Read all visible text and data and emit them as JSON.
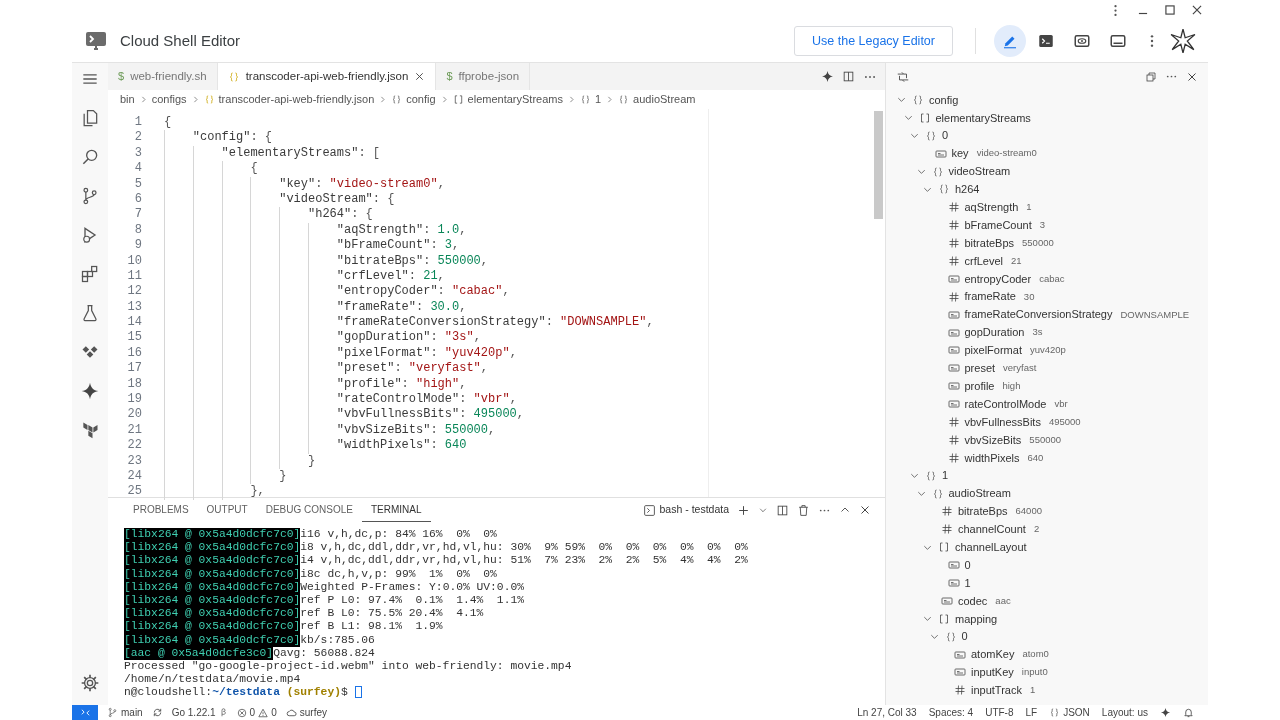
{
  "header": {
    "title": "Cloud Shell Editor",
    "legacy_button": "Use the Legacy Editor",
    "mode_buttons": [
      {
        "kind": "editor",
        "selected": true
      },
      {
        "kind": "terminal",
        "selected": false
      },
      {
        "kind": "preview",
        "selected": false
      },
      {
        "kind": "panel",
        "selected": false
      }
    ]
  },
  "tabs": [
    {
      "kind": "shell",
      "icon": "$",
      "label": "web-friendly.sh",
      "selected": false
    },
    {
      "kind": "json",
      "label": "transcoder-api-web-friendly.json",
      "selected": true
    },
    {
      "kind": "shell",
      "icon": "$",
      "label": "ffprobe-json",
      "selected": false
    }
  ],
  "breadcrumb": [
    {
      "kind": "folder",
      "label": "bin"
    },
    {
      "kind": "folder",
      "label": "configs"
    },
    {
      "kind": "file",
      "label": "transcoder-api-web-friendly.json"
    },
    {
      "kind": "object",
      "label": "config"
    },
    {
      "kind": "array",
      "label": "elementaryStreams"
    },
    {
      "kind": "object",
      "label": "1"
    },
    {
      "kind": "object",
      "label": "audioStream"
    }
  ],
  "code_lines": [
    {
      "number": "1",
      "text": "{"
    },
    {
      "number": "2",
      "text": "    \"config\": {"
    },
    {
      "number": "3",
      "text": "        \"elementaryStreams\": ["
    },
    {
      "number": "4",
      "text": "            {"
    },
    {
      "number": "5",
      "text": "                \"key\": \"video-stream0\","
    },
    {
      "number": "6",
      "text": "                \"videoStream\": {"
    },
    {
      "number": "7",
      "text": "                    \"h264\": {"
    },
    {
      "number": "8",
      "text": "                        \"aqStrength\": 1.0,"
    },
    {
      "number": "9",
      "text": "                        \"bFrameCount\": 3,"
    },
    {
      "number": "10",
      "text": "                        \"bitrateBps\": 550000,"
    },
    {
      "number": "11",
      "text": "                        \"crfLevel\": 21,"
    },
    {
      "number": "12",
      "text": "                        \"entropyCoder\": \"cabac\","
    },
    {
      "number": "13",
      "text": "                        \"frameRate\": 30.0,"
    },
    {
      "number": "14",
      "text": "                        \"frameRateConversionStrategy\": \"DOWNSAMPLE\","
    },
    {
      "number": "15",
      "text": "                        \"gopDuration\": \"3s\","
    },
    {
      "number": "16",
      "text": "                        \"pixelFormat\": \"yuv420p\","
    },
    {
      "number": "17",
      "text": "                        \"preset\": \"veryfast\","
    },
    {
      "number": "18",
      "text": "                        \"profile\": \"high\","
    },
    {
      "number": "19",
      "text": "                        \"rateControlMode\": \"vbr\","
    },
    {
      "number": "20",
      "text": "                        \"vbvFullnessBits\": 495000,"
    },
    {
      "number": "21",
      "text": "                        \"vbvSizeBits\": 550000,"
    },
    {
      "number": "22",
      "text": "                        \"widthPixels\": 640"
    },
    {
      "number": "23",
      "text": "                    }"
    },
    {
      "number": "24",
      "text": "                }"
    },
    {
      "number": "25",
      "text": "            },"
    }
  ],
  "panel_tabs": [
    {
      "label": "PROBLEMS",
      "selected": false
    },
    {
      "label": "OUTPUT",
      "selected": false
    },
    {
      "label": "DEBUG CONSOLE",
      "selected": false
    },
    {
      "label": "TERMINAL",
      "selected": true
    }
  ],
  "terminal_name": "bash - testdata",
  "terminal_lines": [
    {
      "prefix": "[libx264 @ 0x5a4d0dcfc7c0]",
      "text": "i16 v,h,dc,p: 84% 16%  0%  0%"
    },
    {
      "prefix": "[libx264 @ 0x5a4d0dcfc7c0]",
      "text": "i8 v,h,dc,ddl,ddr,vr,hd,vl,hu: 30%  9% 59%  0%  0%  0%  0%  0%  0%"
    },
    {
      "prefix": "[libx264 @ 0x5a4d0dcfc7c0]",
      "text": "i4 v,h,dc,ddl,ddr,vr,hd,vl,hu: 51%  7% 23%  2%  2%  5%  4%  4%  2%"
    },
    {
      "prefix": "[libx264 @ 0x5a4d0dcfc7c0]",
      "text": "i8c dc,h,v,p: 99%  1%  0%  0%"
    },
    {
      "prefix": "[libx264 @ 0x5a4d0dcfc7c0]",
      "text": "Weighted P-Frames: Y:0.0% UV:0.0%"
    },
    {
      "prefix": "[libx264 @ 0x5a4d0dcfc7c0]",
      "text": "ref P L0: 97.4%  0.1%  1.4%  1.1%"
    },
    {
      "prefix": "[libx264 @ 0x5a4d0dcfc7c0]",
      "text": "ref B L0: 75.5% 20.4%  4.1%"
    },
    {
      "prefix": "[libx264 @ 0x5a4d0dcfc7c0]",
      "text": "ref B L1: 98.1%  1.9%"
    },
    {
      "prefix": "[libx264 @ 0x5a4d0dcfc7c0]",
      "text": "kb/s:785.06"
    },
    {
      "prefix": "[aac @ 0x5a4d0dcfe3c0]",
      "text": "Qavg: 56088.824"
    },
    {
      "text": "Processed \"go-google-project-id.webm\" into web-friendly: movie.mp4"
    },
    {
      "text": "/home/n/testdata/movie.mp4"
    }
  ],
  "prompt": {
    "user": "n@cloudshell:",
    "path": "~/testdata",
    "project": "(surfey)",
    "symbol": "$"
  },
  "outline": [
    {
      "kind": "object",
      "label": "config",
      "expanded": true,
      "children": [
        {
          "kind": "array",
          "label": "elementaryStreams",
          "expanded": true,
          "children": [
            {
              "kind": "object",
              "label": "0",
              "expanded": true,
              "children": [
                {
                  "kind": "string",
                  "label": "key",
                  "value": "video-stream0"
                },
                {
                  "kind": "object",
                  "label": "videoStream",
                  "expanded": true,
                  "children": [
                    {
                      "kind": "object",
                      "label": "h264",
                      "expanded": true,
                      "children": [
                        {
                          "kind": "number",
                          "label": "aqStrength",
                          "value": "1"
                        },
                        {
                          "kind": "number",
                          "label": "bFrameCount",
                          "value": "3"
                        },
                        {
                          "kind": "number",
                          "label": "bitrateBps",
                          "value": "550000"
                        },
                        {
                          "kind": "number",
                          "label": "crfLevel",
                          "value": "21"
                        },
                        {
                          "kind": "string",
                          "label": "entropyCoder",
                          "value": "cabac"
                        },
                        {
                          "kind": "number",
                          "label": "frameRate",
                          "value": "30"
                        },
                        {
                          "kind": "string",
                          "label": "frameRateConversionStrategy",
                          "value": "DOWNSAMPLE"
                        },
                        {
                          "kind": "string",
                          "label": "gopDuration",
                          "value": "3s"
                        },
                        {
                          "kind": "string",
                          "label": "pixelFormat",
                          "value": "yuv420p"
                        },
                        {
                          "kind": "string",
                          "label": "preset",
                          "value": "veryfast"
                        },
                        {
                          "kind": "string",
                          "label": "profile",
                          "value": "high"
                        },
                        {
                          "kind": "string",
                          "label": "rateControlMode",
                          "value": "vbr"
                        },
                        {
                          "kind": "number",
                          "label": "vbvFullnessBits",
                          "value": "495000"
                        },
                        {
                          "kind": "number",
                          "label": "vbvSizeBits",
                          "value": "550000"
                        },
                        {
                          "kind": "number",
                          "label": "widthPixels",
                          "value": "640"
                        }
                      ]
                    }
                  ]
                }
              ]
            },
            {
              "kind": "object",
              "label": "1",
              "expanded": true,
              "children": [
                {
                  "kind": "object",
                  "label": "audioStream",
                  "expanded": true,
                  "children": [
                    {
                      "kind": "number",
                      "label": "bitrateBps",
                      "value": "64000"
                    },
                    {
                      "kind": "number",
                      "label": "channelCount",
                      "value": "2"
                    },
                    {
                      "kind": "array",
                      "label": "channelLayout",
                      "expanded": true,
                      "children": [
                        {
                          "kind": "string",
                          "label": "0"
                        },
                        {
                          "kind": "string",
                          "label": "1"
                        }
                      ]
                    },
                    {
                      "kind": "string",
                      "label": "codec",
                      "value": "aac"
                    },
                    {
                      "kind": "array",
                      "label": "mapping",
                      "expanded": true,
                      "children": [
                        {
                          "kind": "object",
                          "label": "0",
                          "expanded": true,
                          "children": [
                            {
                              "kind": "string",
                              "label": "atomKey",
                              "value": "atom0"
                            },
                            {
                              "kind": "string",
                              "label": "inputKey",
                              "value": "input0"
                            },
                            {
                              "kind": "number",
                              "label": "inputTrack",
                              "value": "1"
                            }
                          ]
                        }
                      ]
                    }
                  ]
                }
              ]
            }
          ]
        }
      ]
    }
  ],
  "status_bar": {
    "left": [
      {
        "kind": "remote"
      },
      {
        "kind": "branch",
        "label": "main"
      },
      {
        "kind": "sync"
      },
      {
        "kind": "go",
        "label": "Go 1.22.1"
      },
      {
        "kind": "problems",
        "errors": "0",
        "warnings": "0"
      },
      {
        "kind": "cloud",
        "label": "surfey"
      }
    ],
    "right": [
      {
        "kind": "text",
        "label": "Ln 27, Col 33"
      },
      {
        "kind": "text",
        "label": "Spaces: 4"
      },
      {
        "kind": "text",
        "label": "UTF-8"
      },
      {
        "kind": "text",
        "label": "LF"
      },
      {
        "kind": "language",
        "label": "JSON"
      },
      {
        "kind": "text",
        "label": "Layout: us"
      },
      {
        "kind": "sparkle"
      },
      {
        "kind": "bell"
      }
    ]
  }
}
